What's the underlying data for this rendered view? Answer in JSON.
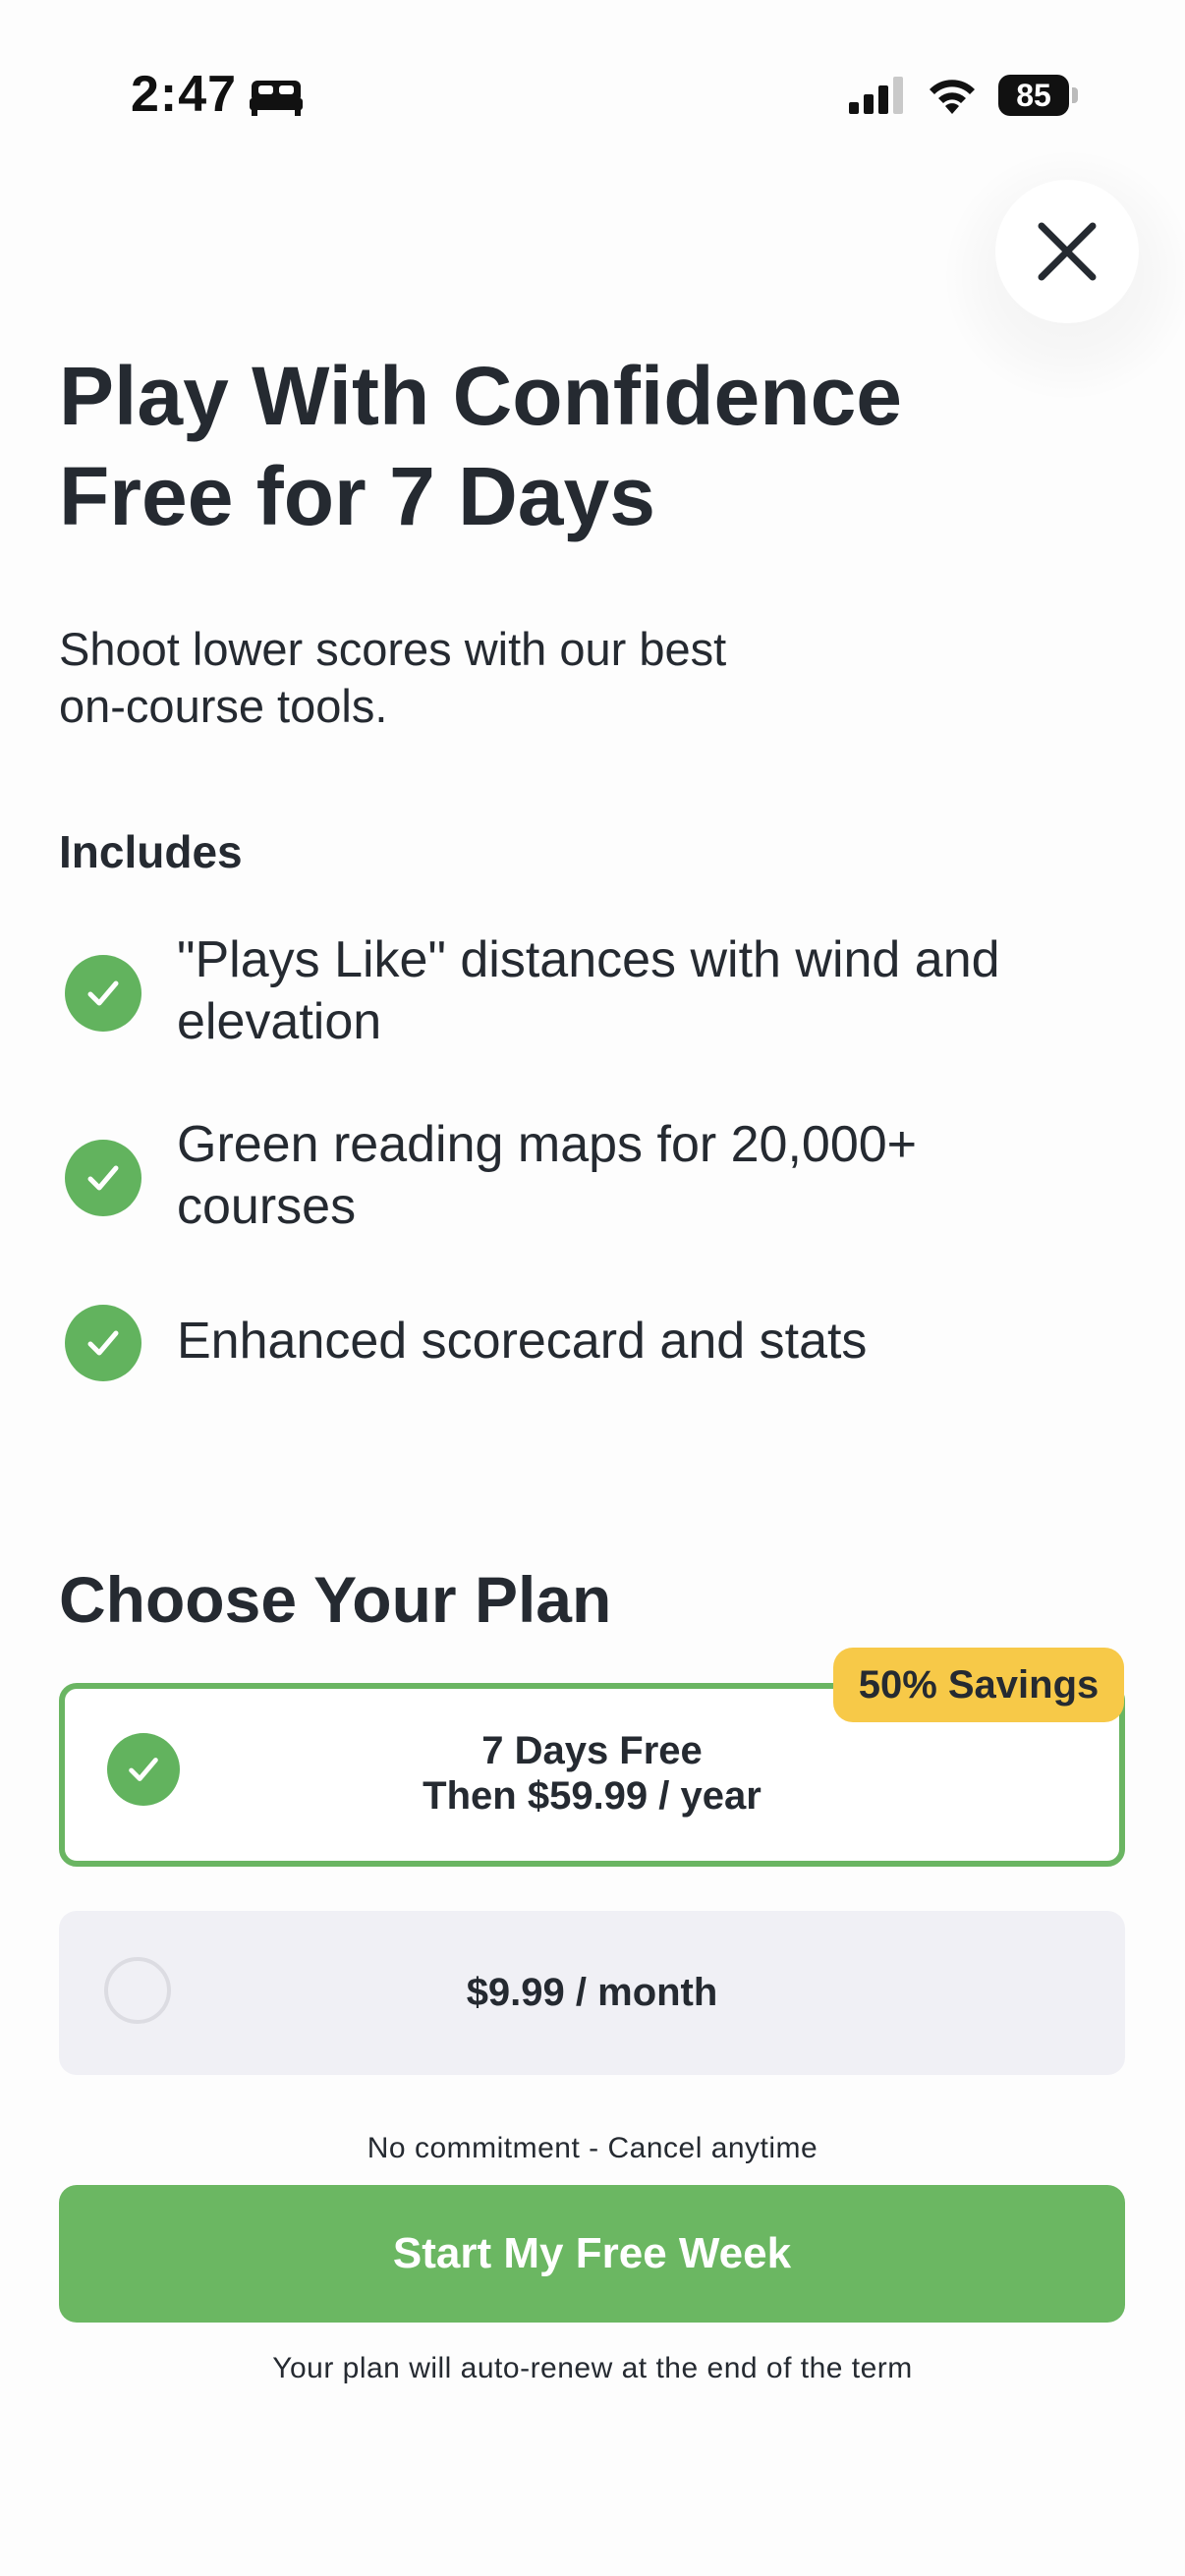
{
  "status_bar": {
    "time": "2:47",
    "focus_icon": "bed-icon",
    "signal_icon": "cellular-signal-icon",
    "wifi_icon": "wifi-icon",
    "battery_level": "85"
  },
  "close_icon": "close-icon",
  "header": {
    "title_lines": [
      "Play With Confidence",
      "Free for 7 Days"
    ],
    "subtitle_lines": [
      "Shoot lower scores with our best",
      "on-course tools."
    ]
  },
  "includes": {
    "label": "Includes",
    "items": [
      {
        "lines": [
          "\"Plays Like\" distances with wind and",
          "elevation"
        ],
        "icon": "check-circle-icon"
      },
      {
        "lines": [
          "Green reading maps for 20,000+",
          "courses"
        ],
        "icon": "check-circle-icon"
      },
      {
        "lines": [
          "Enhanced scorecard and stats"
        ],
        "icon": "check-circle-icon"
      }
    ]
  },
  "plans": {
    "heading": "Choose Your Plan",
    "annual": {
      "selected": true,
      "line1": "7 Days Free",
      "line2": "Then $59.99 / year",
      "badge": "50% Savings"
    },
    "monthly": {
      "selected": false,
      "label": "$9.99 / month"
    }
  },
  "footer": {
    "no_commitment": "No commitment - Cancel anytime",
    "cta_label": "Start My Free Week",
    "auto_renew": "Your plan will auto-renew at the end of the term"
  },
  "colors": {
    "accent_green": "#6bb762",
    "badge_yellow": "#f7c948",
    "text_dark": "#252a31",
    "monthly_card_bg": "#f0f0f5"
  }
}
